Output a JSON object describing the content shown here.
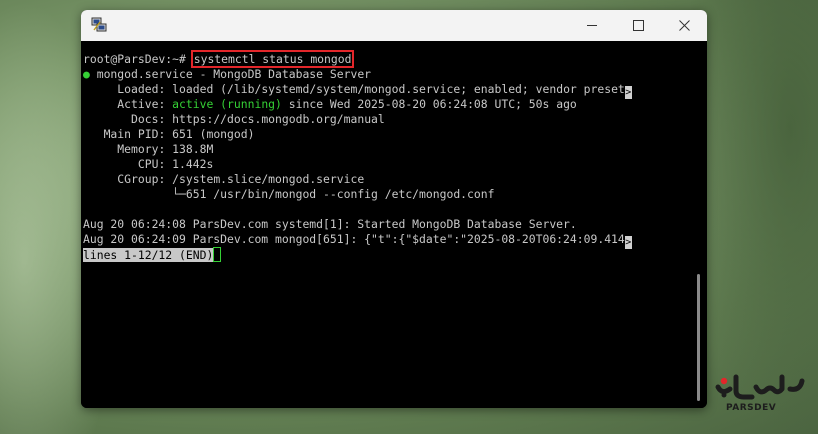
{
  "window": {
    "icon": "putty-icon",
    "controls": [
      "minimize-icon",
      "maximize-icon",
      "close-icon"
    ]
  },
  "terminal": {
    "prompt": "root@ParsDev:~#",
    "command": "systemctl status mongod",
    "service_dot": "●",
    "service_line": "mongod.service - MongoDB Database Server",
    "loaded_label": "Loaded:",
    "loaded_value": "loaded (/lib/systemd/system/mongod.service; enabled; vendor preset",
    "active_label": "Active:",
    "active_state": "active (running)",
    "active_since": "since Wed 2025-08-20 06:24:08 UTC; 50s ago",
    "docs_label": "Docs:",
    "docs_value": "https://docs.mongodb.org/manual",
    "mainpid_label": "Main PID:",
    "mainpid_value": "651 (mongod)",
    "memory_label": "Memory:",
    "memory_value": "138.8M",
    "cpu_label": "CPU:",
    "cpu_value": "1.442s",
    "cgroup_label": "CGroup:",
    "cgroup_value": "/system.slice/mongod.service",
    "cgroup_child": "└─651 /usr/bin/mongod --config /etc/mongod.conf",
    "log1": "Aug 20 06:24:08 ParsDev.com systemd[1]: Started MongoDB Database Server.",
    "log2": "Aug 20 06:24:09 ParsDev.com mongod[651]: {\"t\":{\"$date\":\"2025-08-20T06:24:09.414",
    "truncation_marker": ">",
    "pager_status": "lines 1-12/12 (END)"
  },
  "logo": {
    "text": "PARSDEV"
  },
  "colors": {
    "terminal_bg": "#000000",
    "terminal_fg": "#c8c8c8",
    "green": "#35d035",
    "highlight_box": "#e3262a"
  }
}
